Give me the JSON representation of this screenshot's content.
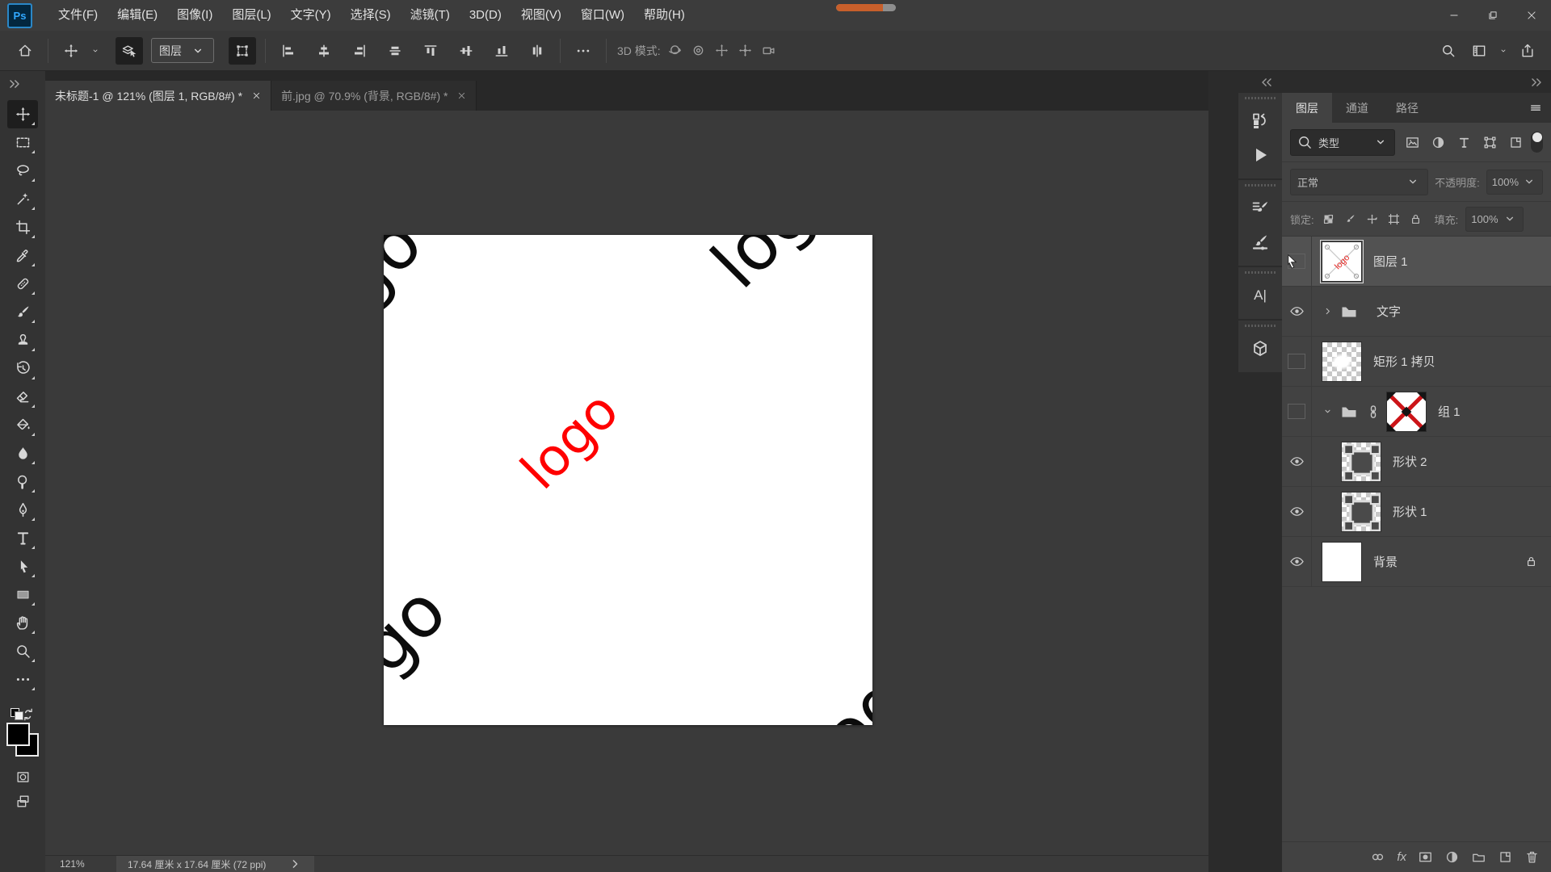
{
  "app": {
    "name": "Ps",
    "accent": "#31a8ff"
  },
  "title_bar": {
    "menus": [
      "文件(F)",
      "编辑(E)",
      "图像(I)",
      "图层(L)",
      "文字(Y)",
      "选择(S)",
      "滤镜(T)",
      "3D(D)",
      "视图(V)",
      "窗口(W)",
      "帮助(H)"
    ],
    "progress_percent": 78,
    "progress_color": "#c75f2b",
    "window_controls": [
      "minimize",
      "restore",
      "close"
    ]
  },
  "options_bar": {
    "tool_select_label": "图层",
    "mode_label": "3D 模式:",
    "align_icons": [
      "align-left",
      "align-center-h",
      "align-right",
      "dist-h",
      "align-top",
      "align-middle",
      "align-bottom",
      "dist-v"
    ],
    "threed_icons": [
      "orbit",
      "roll",
      "pan",
      "slide",
      "camera"
    ],
    "right_icons": [
      "search",
      "workspace",
      "share"
    ]
  },
  "tabs": [
    {
      "label": "未标题-1 @ 121% (图层 1, RGB/8#) *",
      "active": true
    },
    {
      "label": "前.jpg @ 70.9% (背景, RGB/8#) *",
      "active": false
    }
  ],
  "toolbar": {
    "tools": [
      {
        "name": "move-tool",
        "icon": "move",
        "active": true
      },
      {
        "name": "rectangular-marquee-tool",
        "icon": "marquee"
      },
      {
        "name": "lasso-tool",
        "icon": "lasso"
      },
      {
        "name": "magic-wand-tool",
        "icon": "wand"
      },
      {
        "name": "crop-tool",
        "icon": "crop"
      },
      {
        "name": "eyedropper-tool",
        "icon": "eyedropper"
      },
      {
        "name": "spot-healing-brush-tool",
        "icon": "healing"
      },
      {
        "name": "brush-tool",
        "icon": "brush"
      },
      {
        "name": "clone-stamp-tool",
        "icon": "stamp"
      },
      {
        "name": "history-brush-tool",
        "icon": "history-brush"
      },
      {
        "name": "eraser-tool",
        "icon": "eraser"
      },
      {
        "name": "paint-bucket-tool",
        "icon": "bucket"
      },
      {
        "name": "blur-tool",
        "icon": "blur"
      },
      {
        "name": "dodge-tool",
        "icon": "dodge"
      },
      {
        "name": "pen-tool",
        "icon": "pen"
      },
      {
        "name": "type-tool",
        "icon": "type"
      },
      {
        "name": "path-selection-tool",
        "icon": "path-select"
      },
      {
        "name": "rectangle-tool",
        "icon": "shape"
      },
      {
        "name": "hand-tool",
        "icon": "hand"
      },
      {
        "name": "zoom-tool",
        "icon": "zoom"
      },
      {
        "name": "edit-toolbar",
        "icon": "ellipsis"
      }
    ]
  },
  "canvas": {
    "logo_text": "logo",
    "logo_color": "#ff0000",
    "fragment_color": "#0c0c0c",
    "rotation_deg": -45
  },
  "status_bar": {
    "zoom_value": "121%",
    "doc_info": "17.64 厘米 x 17.64 厘米 (72 ppi)"
  },
  "dock_strip": {
    "groups": [
      [
        "panel-history",
        "panel-actions"
      ],
      [
        "panel-brush-settings",
        "panel-brushes"
      ],
      [
        "panel-character"
      ],
      [
        "panel-3d"
      ]
    ]
  },
  "layers_panel": {
    "tabs": [
      {
        "label": "图层",
        "active": true
      },
      {
        "label": "通道",
        "active": false
      },
      {
        "label": "路径",
        "active": false
      }
    ],
    "search_type_label": "类型",
    "filter_icons": [
      "kind-image",
      "kind-adjust",
      "kind-type",
      "kind-shape",
      "kind-smart"
    ],
    "blend_mode": "正常",
    "opacity_label": "不透明度:",
    "opacity_value": "100%",
    "lock_label": "锁定:",
    "lock_icons": [
      "lock-checker",
      "lock-brush",
      "lock-move",
      "lock-artboard",
      "lock-lock"
    ],
    "fill_label": "填充:",
    "fill_value": "100%",
    "layers": [
      {
        "name": "图层 1",
        "visible": false,
        "selected": true,
        "thumb": "logo-preview",
        "cursor": true
      },
      {
        "name": "文字",
        "visible": true,
        "kind": "group",
        "expanded": false
      },
      {
        "name": "矩形 1 拷贝",
        "visible": false,
        "thumb": "checker-blob"
      },
      {
        "name": "组 1",
        "visible": false,
        "kind": "group",
        "expanded": true,
        "linked": true,
        "thumb": "red-x"
      },
      {
        "name": "形状 2",
        "visible": true,
        "thumb": "checker-shape",
        "indent": 1
      },
      {
        "name": "形状 1",
        "visible": true,
        "thumb": "checker-shape",
        "indent": 1
      },
      {
        "name": "背景",
        "visible": true,
        "thumb": "white",
        "locked": true
      }
    ],
    "bottom_icons": [
      "link",
      "fx",
      "mask",
      "adjust",
      "new-group",
      "new-layer",
      "trash"
    ]
  }
}
